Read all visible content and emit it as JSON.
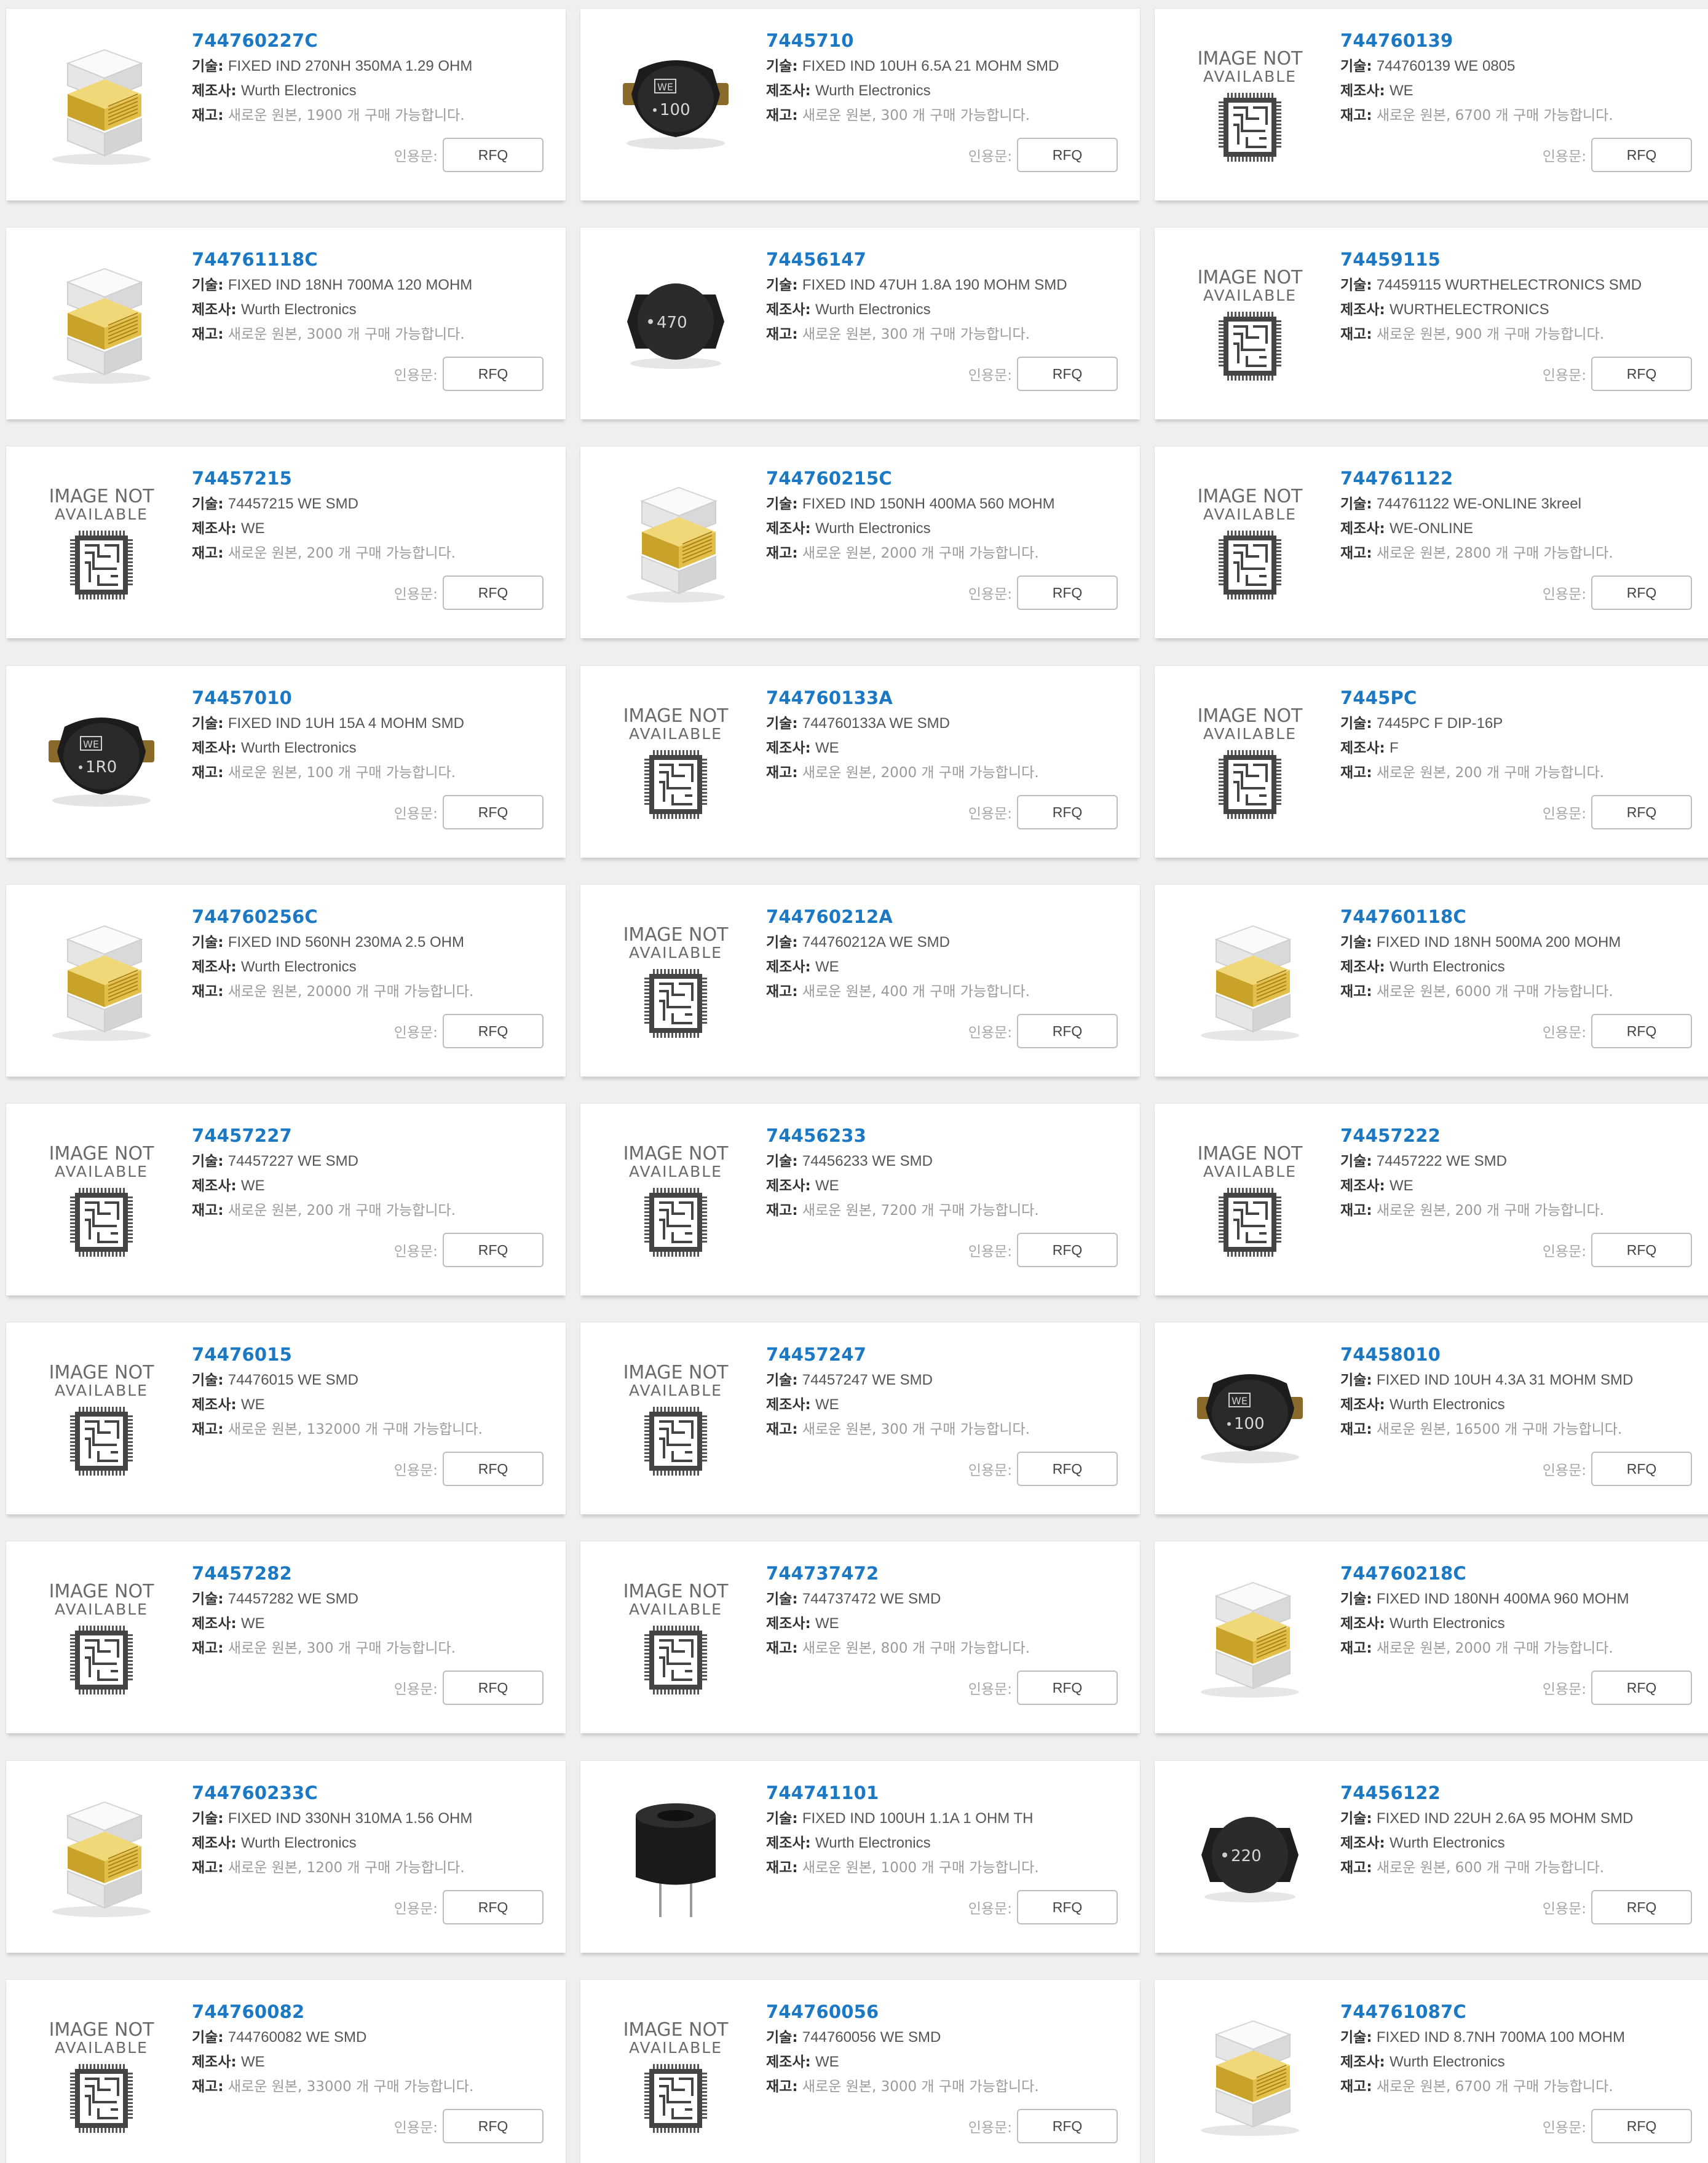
{
  "labels": {
    "description": "기술:",
    "manufacturer": "제조사:",
    "stock": "재고:",
    "quote": "인용문:",
    "rfq_button": "RFQ"
  },
  "placeholder": {
    "line1": "IMAGE NOT",
    "line2": "AVAILABLE"
  },
  "colors": {
    "part_number": "#1b78c4",
    "stock_text": "#9a9a9a",
    "page_background": "#efefef",
    "card_background": "#ffffff"
  },
  "products": [
    {
      "part": "744760227C",
      "desc": "FIXED IND 270NH 350MA 1.29 OHM",
      "mfr": "Wurth Electronics",
      "stock": "새로운 원본, 1900 개 구매 가능합니다.",
      "image": "chip-inductor"
    },
    {
      "part": "7445710",
      "desc": "FIXED IND 10UH 6.5A 21 MOHM SMD",
      "mfr": "Wurth Electronics",
      "stock": "새로운 원본, 300 개 구매 가능합니다.",
      "image": "power-inductor",
      "marking": "100"
    },
    {
      "part": "744760139",
      "desc": "744760139 WE 0805",
      "mfr": "WE",
      "stock": "새로운 원본, 6700 개 구매 가능합니다.",
      "image": "not-available"
    },
    {
      "part": "744761118C",
      "desc": "FIXED IND 18NH 700MA 120 MOHM",
      "mfr": "Wurth Electronics",
      "stock": "새로운 원본, 3000 개 구매 가능합니다.",
      "image": "chip-inductor"
    },
    {
      "part": "74456147",
      "desc": "FIXED IND 47UH 1.8A 190 MOHM SMD",
      "mfr": "Wurth Electronics",
      "stock": "새로운 원본, 300 개 구매 가능합니다.",
      "image": "round-inductor",
      "marking": "470"
    },
    {
      "part": "74459115",
      "desc": "74459115 WURTHELECTRONICS SMD",
      "mfr": "WURTHELECTRONICS",
      "stock": "새로운 원본, 900 개 구매 가능합니다.",
      "image": "not-available"
    },
    {
      "part": "74457215",
      "desc": "74457215 WE SMD",
      "mfr": "WE",
      "stock": "새로운 원본, 200 개 구매 가능합니다.",
      "image": "not-available"
    },
    {
      "part": "744760215C",
      "desc": "FIXED IND 150NH 400MA 560 MOHM",
      "mfr": "Wurth Electronics",
      "stock": "새로운 원본, 2000 개 구매 가능합니다.",
      "image": "chip-inductor"
    },
    {
      "part": "744761122",
      "desc": "744761122 WE-ONLINE 3kreel",
      "mfr": "WE-ONLINE",
      "stock": "새로운 원본, 2800 개 구매 가능합니다.",
      "image": "not-available"
    },
    {
      "part": "74457010",
      "desc": "FIXED IND 1UH 15A 4 MOHM SMD",
      "mfr": "Wurth Electronics",
      "stock": "새로운 원본, 100 개 구매 가능합니다.",
      "image": "power-inductor",
      "marking": "1R0"
    },
    {
      "part": "744760133A",
      "desc": "744760133A WE SMD",
      "mfr": "WE",
      "stock": "새로운 원본, 2000 개 구매 가능합니다.",
      "image": "not-available"
    },
    {
      "part": "7445PC",
      "desc": "7445PC F DIP-16P",
      "mfr": "F",
      "stock": "새로운 원본, 200 개 구매 가능합니다.",
      "image": "not-available"
    },
    {
      "part": "744760256C",
      "desc": "FIXED IND 560NH 230MA 2.5 OHM",
      "mfr": "Wurth Electronics",
      "stock": "새로운 원본, 20000 개 구매 가능합니다.",
      "image": "chip-inductor"
    },
    {
      "part": "744760212A",
      "desc": "744760212A WE SMD",
      "mfr": "WE",
      "stock": "새로운 원본, 400 개 구매 가능합니다.",
      "image": "not-available"
    },
    {
      "part": "744760118C",
      "desc": "FIXED IND 18NH 500MA 200 MOHM",
      "mfr": "Wurth Electronics",
      "stock": "새로운 원본, 6000 개 구매 가능합니다.",
      "image": "chip-inductor"
    },
    {
      "part": "74457227",
      "desc": "74457227 WE SMD",
      "mfr": "WE",
      "stock": "새로운 원본, 200 개 구매 가능합니다.",
      "image": "not-available"
    },
    {
      "part": "74456233",
      "desc": "74456233 WE SMD",
      "mfr": "WE",
      "stock": "새로운 원본, 7200 개 구매 가능합니다.",
      "image": "not-available"
    },
    {
      "part": "74457222",
      "desc": "74457222 WE SMD",
      "mfr": "WE",
      "stock": "새로운 원본, 200 개 구매 가능합니다.",
      "image": "not-available"
    },
    {
      "part": "74476015",
      "desc": "74476015 WE SMD",
      "mfr": "WE",
      "stock": "새로운 원본, 132000 개 구매 가능합니다.",
      "image": "not-available"
    },
    {
      "part": "74457247",
      "desc": "74457247 WE SMD",
      "mfr": "WE",
      "stock": "새로운 원본, 300 개 구매 가능합니다.",
      "image": "not-available"
    },
    {
      "part": "74458010",
      "desc": "FIXED IND 10UH 4.3A 31 MOHM SMD",
      "mfr": "Wurth Electronics",
      "stock": "새로운 원본, 16500 개 구매 가능합니다.",
      "image": "power-inductor",
      "marking": "100"
    },
    {
      "part": "74457282",
      "desc": "74457282 WE SMD",
      "mfr": "WE",
      "stock": "새로운 원본, 300 개 구매 가능합니다.",
      "image": "not-available"
    },
    {
      "part": "744737472",
      "desc": "744737472 WE SMD",
      "mfr": "WE",
      "stock": "새로운 원본, 800 개 구매 가능합니다.",
      "image": "not-available"
    },
    {
      "part": "744760218C",
      "desc": "FIXED IND 180NH 400MA 960 MOHM",
      "mfr": "Wurth Electronics",
      "stock": "새로운 원본, 2000 개 구매 가능합니다.",
      "image": "chip-inductor"
    },
    {
      "part": "744760233C",
      "desc": "FIXED IND 330NH 310MA 1.56 OHM",
      "mfr": "Wurth Electronics",
      "stock": "새로운 원본, 1200 개 구매 가능합니다.",
      "image": "chip-inductor"
    },
    {
      "part": "744741101",
      "desc": "FIXED IND 100UH 1.1A 1 OHM TH",
      "mfr": "Wurth Electronics",
      "stock": "새로운 원본, 1000 개 구매 가능합니다.",
      "image": "radial-inductor"
    },
    {
      "part": "74456122",
      "desc": "FIXED IND 22UH 2.6A 95 MOHM SMD",
      "mfr": "Wurth Electronics",
      "stock": "새로운 원본, 600 개 구매 가능합니다.",
      "image": "round-inductor",
      "marking": "220"
    },
    {
      "part": "744760082",
      "desc": "744760082 WE SMD",
      "mfr": "WE",
      "stock": "새로운 원본, 33000 개 구매 가능합니다.",
      "image": "not-available"
    },
    {
      "part": "744760056",
      "desc": "744760056 WE SMD",
      "mfr": "WE",
      "stock": "새로운 원본, 3000 개 구매 가능합니다.",
      "image": "not-available"
    },
    {
      "part": "744761087C",
      "desc": "FIXED IND 8.7NH 700MA 100 MOHM",
      "mfr": "Wurth Electronics",
      "stock": "새로운 원본, 6700 개 구매 가능합니다.",
      "image": "chip-inductor"
    }
  ]
}
